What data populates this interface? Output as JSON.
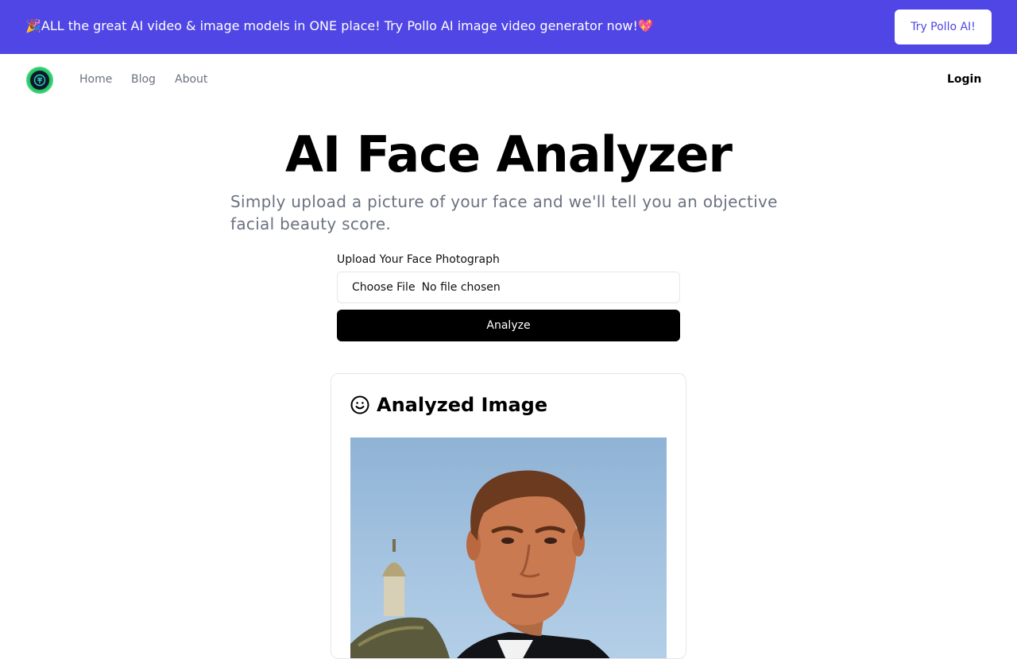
{
  "banner": {
    "text": "🎉ALL the great AI video & image models in ONE place! Try Pollo AI image video generator now!💖",
    "button_label": "Try Pollo AI!"
  },
  "nav": {
    "links": [
      {
        "label": "Home"
      },
      {
        "label": "Blog"
      },
      {
        "label": "About"
      }
    ],
    "login_label": "Login"
  },
  "hero": {
    "title": "AI Face Analyzer",
    "subtitle": "Simply upload a picture of your face and we'll tell you an objective facial beauty score."
  },
  "form": {
    "upload_label": "Upload Your Face Photograph",
    "choose_file_label": "Choose File",
    "file_status": "No file chosen",
    "analyze_label": "Analyze"
  },
  "result": {
    "title": "Analyzed Image",
    "icon": "smile-icon"
  },
  "colors": {
    "banner_bg": "#4f46e5",
    "primary_button": "#000000",
    "muted_text": "#6b7280"
  }
}
